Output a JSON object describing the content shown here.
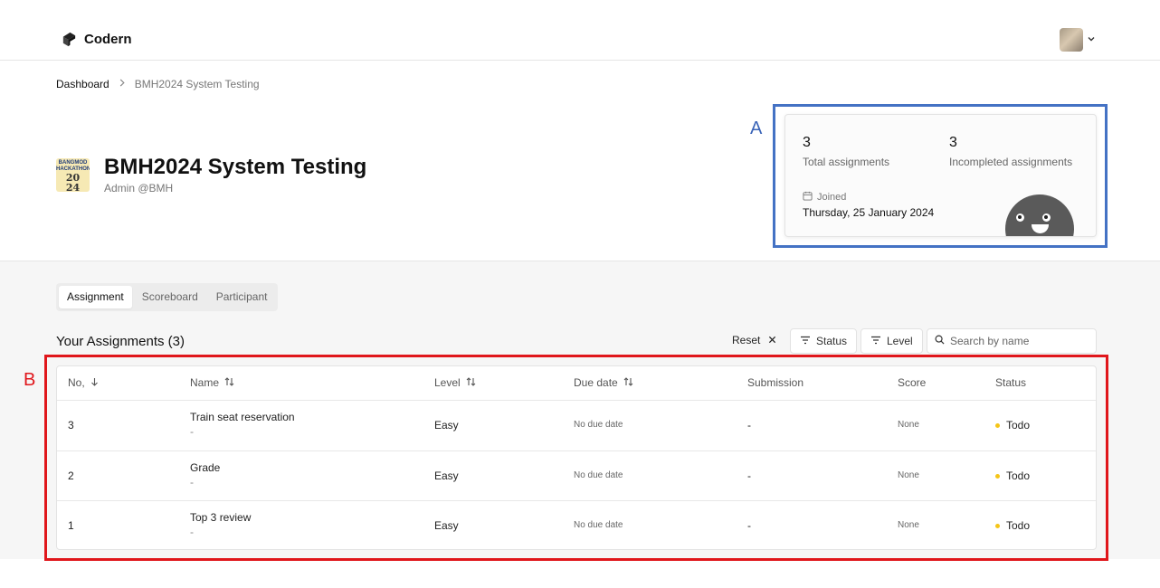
{
  "header": {
    "app_name": "Codern",
    "avatar_icon": "user-avatar",
    "menu_icon": "chevron-down-icon"
  },
  "breadcrumb": {
    "items": [
      "Dashboard",
      "BMH2024 System Testing"
    ]
  },
  "project": {
    "title": "BMH2024 System Testing",
    "subtitle": "Admin @BMH",
    "logo_lines": [
      "BANGMOD",
      "HACKATHON",
      "20",
      "24"
    ]
  },
  "annotations": {
    "a": "A",
    "b": "B",
    "a_color": "#4472c4",
    "b_color": "#e0161b"
  },
  "stats": {
    "total_value": "3",
    "total_label": "Total assignments",
    "incompleted_value": "3",
    "incompleted_label": "Incompleted assignments",
    "joined_label": "Joined",
    "joined_date": "Thursday, 25 January 2024"
  },
  "tabs": [
    {
      "label": "Assignment",
      "active": true
    },
    {
      "label": "Scoreboard",
      "active": false
    },
    {
      "label": "Participant",
      "active": false
    }
  ],
  "assignments": {
    "title": "Your Assignments (3)",
    "reset_label": "Reset",
    "status_filter_label": "Status",
    "level_filter_label": "Level",
    "search_placeholder": "Search by name",
    "columns": [
      "No,",
      "Name",
      "Level",
      "Due date",
      "Submission",
      "Score",
      "Status"
    ],
    "status_color": "#f5c518",
    "rows": [
      {
        "no": "3",
        "name": "Train seat reservation",
        "desc": "-",
        "level": "Easy",
        "due": "No due date",
        "submission": "-",
        "score": "None",
        "status": "Todo"
      },
      {
        "no": "2",
        "name": "Grade",
        "desc": "-",
        "level": "Easy",
        "due": "No due date",
        "submission": "-",
        "score": "None",
        "status": "Todo"
      },
      {
        "no": "1",
        "name": "Top 3 review",
        "desc": "-",
        "level": "Easy",
        "due": "No due date",
        "submission": "-",
        "score": "None",
        "status": "Todo"
      }
    ]
  }
}
